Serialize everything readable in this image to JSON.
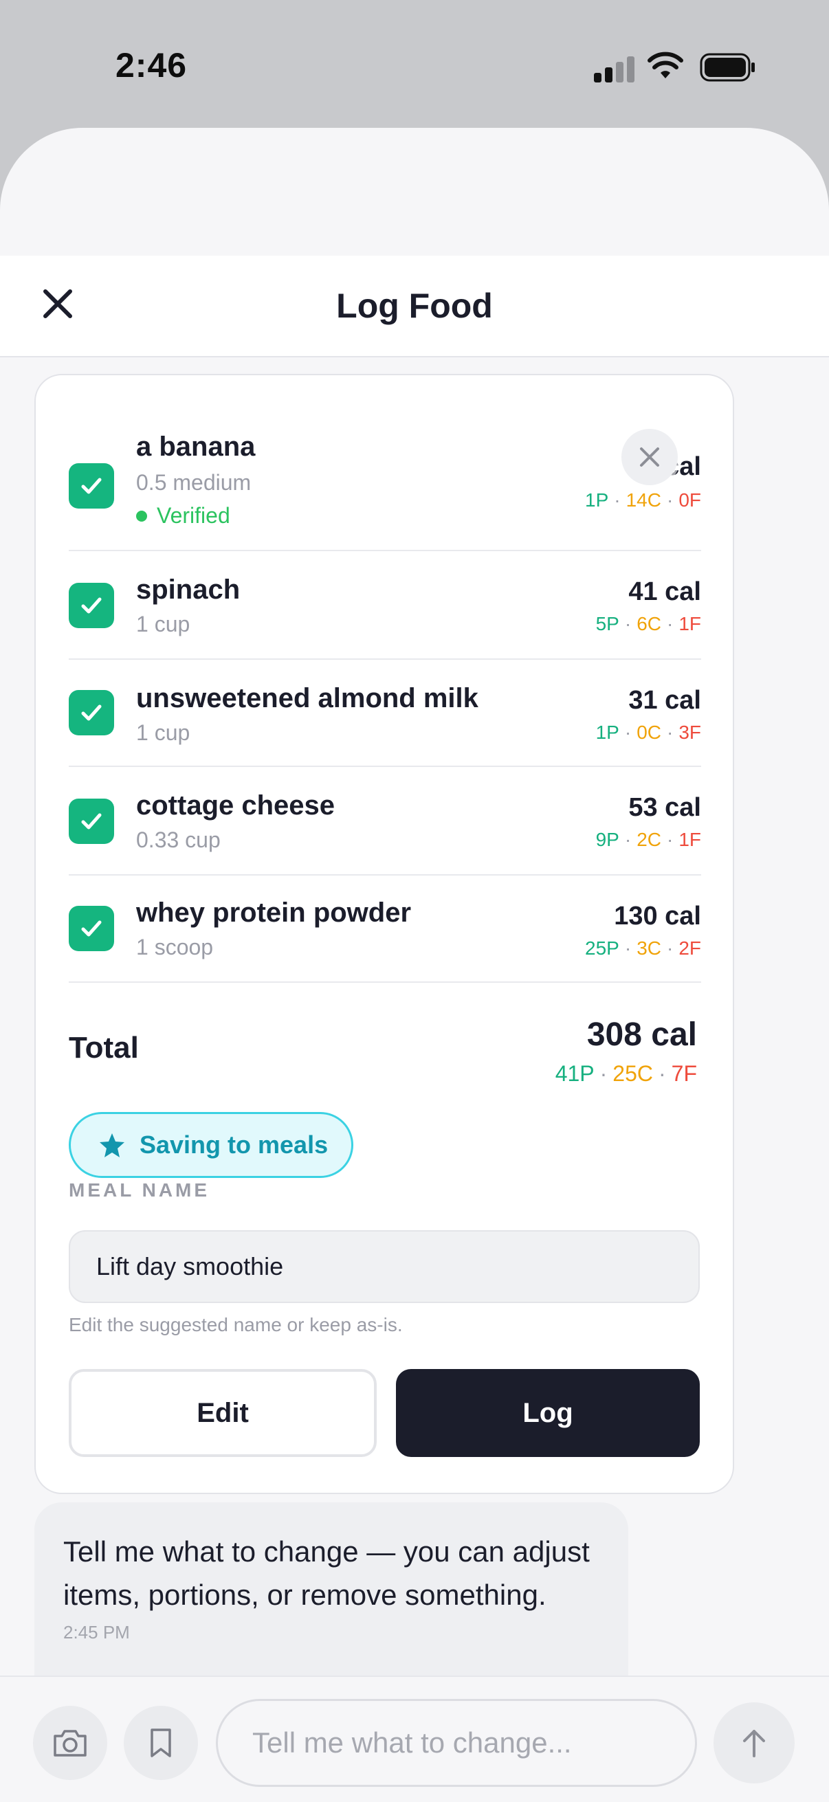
{
  "status_bar": {
    "time": "2:46"
  },
  "header": {
    "title": "Log Food"
  },
  "items": [
    {
      "name": "a banana",
      "qty": "0.5 medium",
      "verified": "Verified",
      "cal": "53 cal",
      "p": "1P",
      "c": "14C",
      "f": "0F"
    },
    {
      "name": "spinach",
      "qty": "1 cup",
      "cal": "41 cal",
      "p": "5P",
      "c": "6C",
      "f": "1F"
    },
    {
      "name": "unsweetened almond milk",
      "qty": "1 cup",
      "cal": "31 cal",
      "p": "1P",
      "c": "0C",
      "f": "3F"
    },
    {
      "name": "cottage cheese",
      "qty": "0.33 cup",
      "cal": "53 cal",
      "p": "9P",
      "c": "2C",
      "f": "1F"
    },
    {
      "name": "whey protein powder",
      "qty": "1 scoop",
      "cal": "130 cal",
      "p": "25P",
      "c": "3C",
      "f": "2F"
    }
  ],
  "total": {
    "label": "Total",
    "cal": "308 cal",
    "p": "41P",
    "c": "25C",
    "f": "7F"
  },
  "saving": {
    "label": "Saving to meals"
  },
  "meal": {
    "label": "MEAL NAME",
    "value": "Lift day smoothie",
    "hint": "Edit the suggested name or keep as-is."
  },
  "actions": {
    "edit": "Edit",
    "log": "Log"
  },
  "chat": {
    "message": "Tell me what to change — you can adjust items, portions, or remove something.",
    "time": "2:45 PM",
    "input_placeholder": "Tell me what to change..."
  },
  "colors": {
    "protein": "#16b07f",
    "carbs": "#f0a30a",
    "fat": "#ee4b3c",
    "check": "#15b57f",
    "accent": "#1296ad"
  }
}
